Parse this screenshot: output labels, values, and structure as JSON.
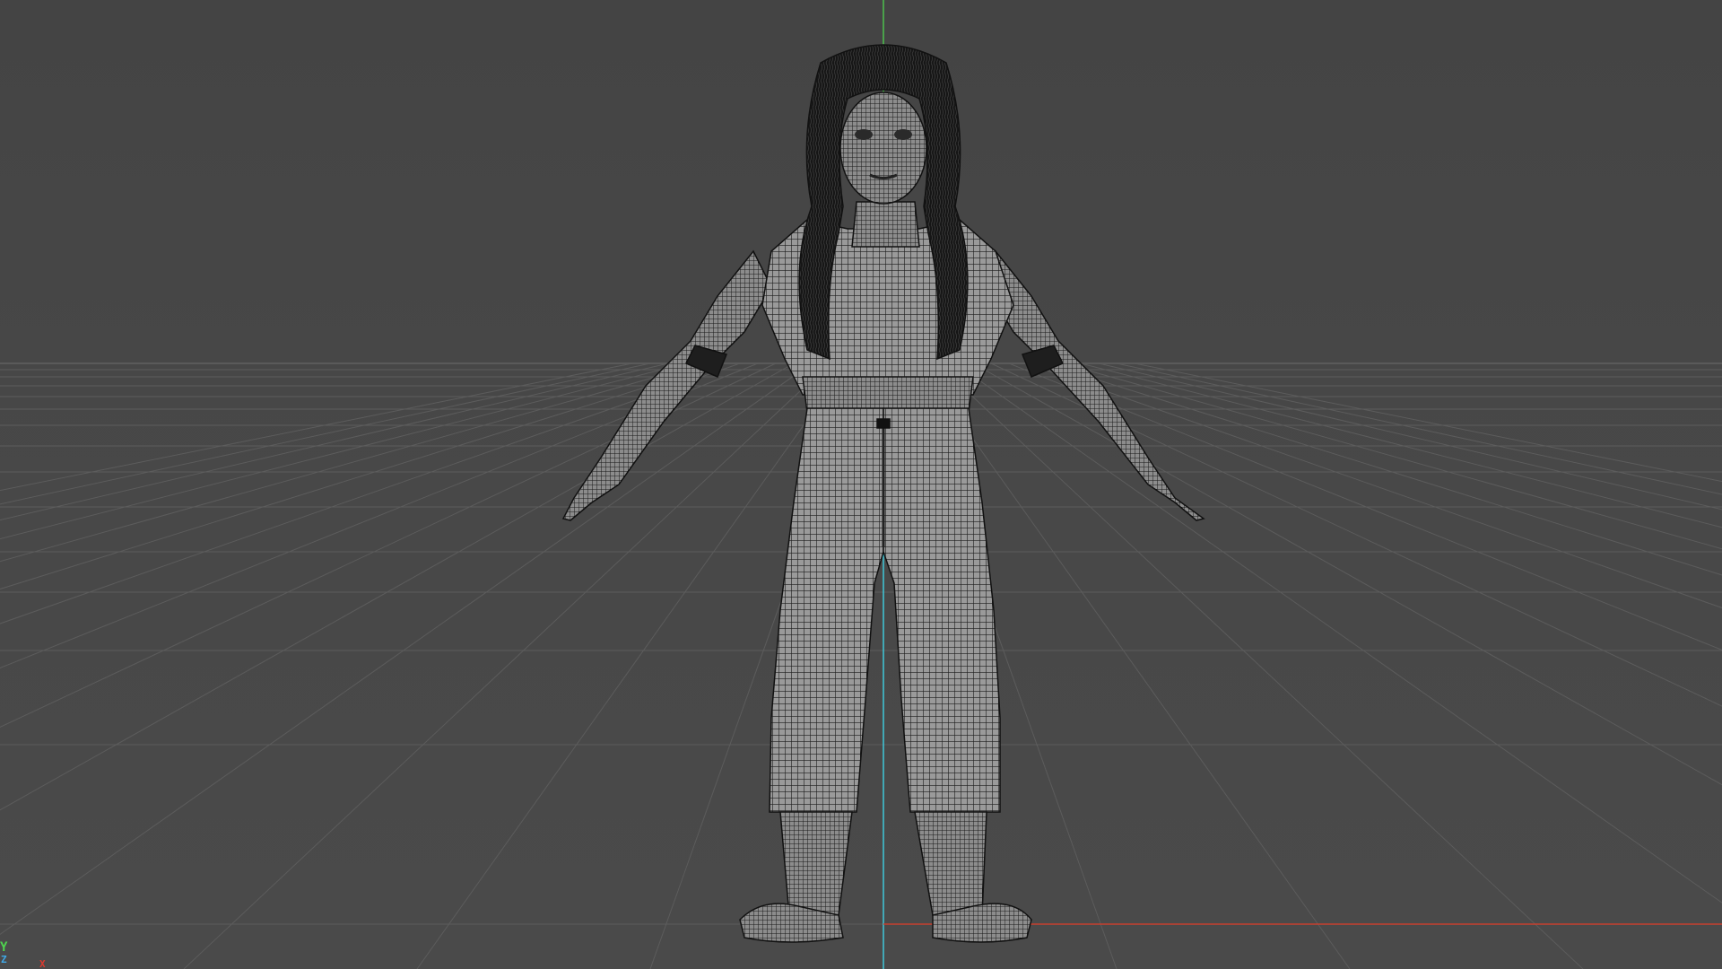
{
  "viewport": {
    "projection": "perspective",
    "display_mode": "wireframe",
    "background_color": "#464646",
    "grid": true
  },
  "axis_gizmo": {
    "y_label": "Y",
    "z_label": "Z",
    "x_label": "X",
    "y_color": "#4fd24f",
    "z_color": "#3fa8e6",
    "x_color": "#d93a2e"
  },
  "model": {
    "type": "character-mesh",
    "pose": "a-pose",
    "wire_color": "#1c1c1c",
    "surface_color": "#8e8e8e"
  },
  "colors": {
    "grid_line": "#5c5c5c",
    "horizon": "#585858",
    "world_y_axis": "#3fc7d9",
    "world_x_axis": "#c8402f",
    "world_z_axis": "#4cc04c"
  }
}
